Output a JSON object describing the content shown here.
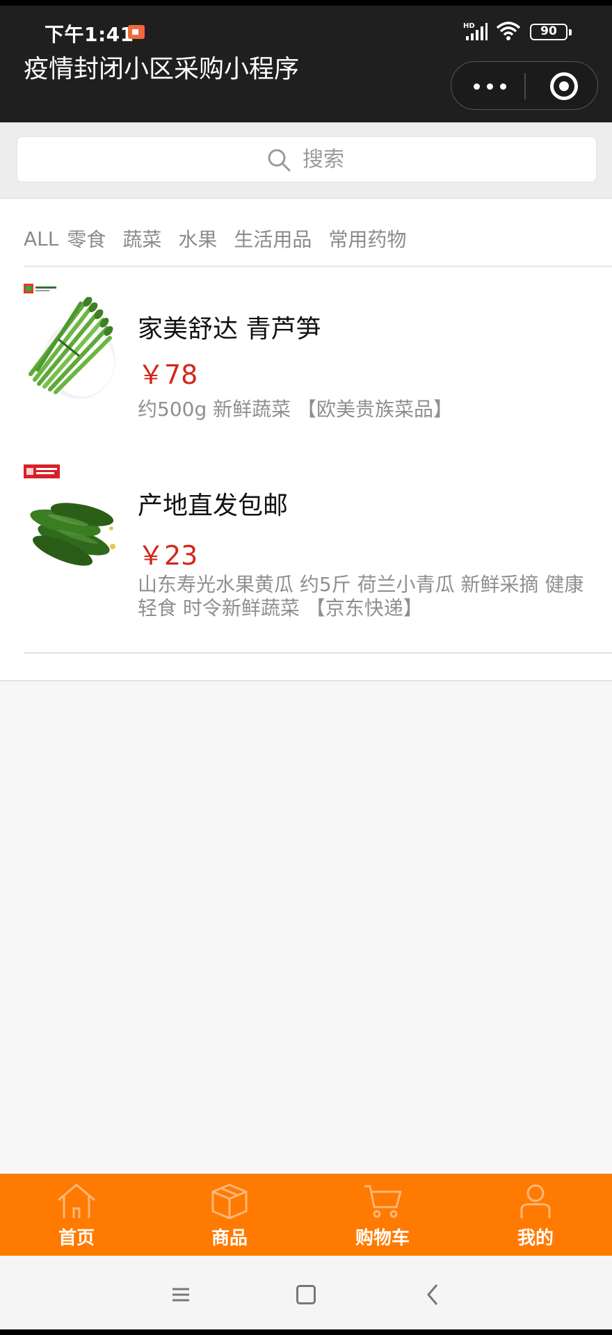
{
  "status_bar": {
    "time": "下午1:41",
    "battery": "90"
  },
  "header": {
    "title": "疫情封闭小区采购小程序"
  },
  "search": {
    "placeholder": "搜索"
  },
  "categories": [
    "ALL",
    "零食",
    "蔬菜",
    "水果",
    "生活用品",
    "常用药物"
  ],
  "products": [
    {
      "title": "家美舒达 青芦笋",
      "price": "￥78",
      "desc": "约500g 新鲜蔬菜 【欧美贵族菜品】"
    },
    {
      "title": "产地直发包邮",
      "price": "￥23",
      "desc": "山东寿光水果黄瓜 约5斤 荷兰小青瓜 新鲜采摘 健康轻食 时令新鲜蔬菜 【京东快递】"
    }
  ],
  "tabbar": {
    "items": [
      {
        "label": "首页",
        "icon": "home-icon"
      },
      {
        "label": "商品",
        "icon": "box-icon"
      },
      {
        "label": "购物车",
        "icon": "cart-icon"
      },
      {
        "label": "我的",
        "icon": "user-icon"
      }
    ]
  },
  "colors": {
    "accent": "#ff7a00",
    "price": "#d4261b",
    "header_bg": "#1f1f1f"
  }
}
